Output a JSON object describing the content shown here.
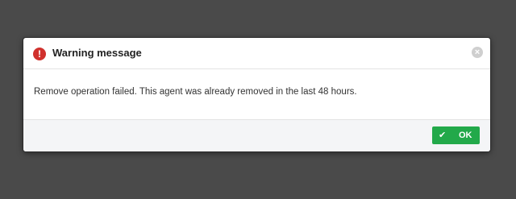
{
  "dialog": {
    "title": "Warning message",
    "icon": "warning-icon",
    "warning_icon_glyph": "!",
    "close_icon": "close-icon",
    "close_glyph": "×",
    "message": "Remove operation failed. This agent was already removed in the last 48 hours.",
    "ok_button": {
      "label": "OK",
      "icon": "check-icon",
      "icon_glyph": "✔"
    }
  },
  "colors": {
    "overlay": "#4a4a4a",
    "warning": "#d0312d",
    "ok_button": "#22a94a",
    "footer_bg": "#f4f5f7"
  }
}
